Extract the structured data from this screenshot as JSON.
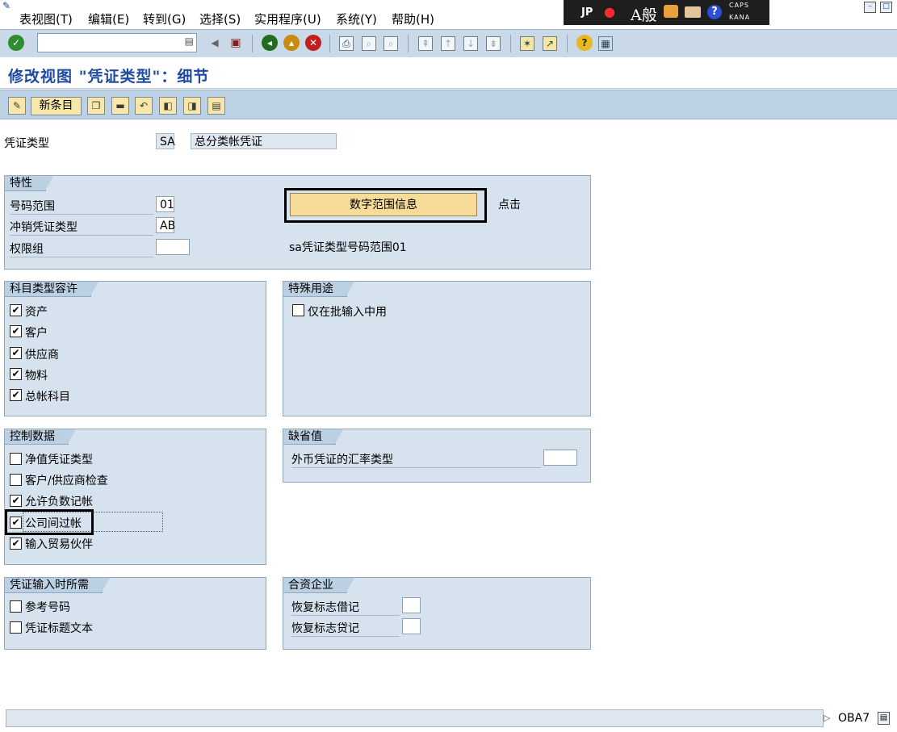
{
  "menu": {
    "items": [
      "表视图(T)",
      "编辑(E)",
      "转到(G)",
      "选择(S)",
      "实用程序(U)",
      "系统(Y)",
      "帮助(H)"
    ]
  },
  "ime": {
    "lang": "JP",
    "mode": "A般",
    "caps": "CAPS",
    "kana": "KANA"
  },
  "toolbar": {
    "command_value": ""
  },
  "title": "修改视图 \"凭证类型\"：细节",
  "app_toolbar": {
    "new_entries": "新条目"
  },
  "header": {
    "doc_type_label": "凭证类型",
    "doc_type_value": "SA",
    "doc_type_desc": "总分类帐凭证"
  },
  "properties": {
    "title": "特性",
    "number_range_label": "号码范围",
    "number_range_value": "01",
    "reverse_type_label": "冲销凭证类型",
    "reverse_type_value": "AB",
    "auth_group_label": "权限组",
    "auth_group_value": "",
    "nr_button": "数字范围信息",
    "click_note": "点击",
    "annotation": "sa凭证类型号码范围01"
  },
  "account_types": {
    "title": "科目类型容许",
    "items": [
      {
        "label": "资产",
        "checked": "✔"
      },
      {
        "label": "客户",
        "checked": "✔"
      },
      {
        "label": "供应商",
        "checked": "✔"
      },
      {
        "label": "物料",
        "checked": "✔"
      },
      {
        "label": "总帐科目",
        "checked": "✔"
      }
    ]
  },
  "special_usage": {
    "title": "特殊用途",
    "items": [
      {
        "label": "仅在批输入中用",
        "checked": ""
      }
    ]
  },
  "control_data": {
    "title": "控制数据",
    "items": [
      {
        "label": "净值凭证类型",
        "checked": ""
      },
      {
        "label": "客户/供应商检查",
        "checked": ""
      },
      {
        "label": "允许负数记帐",
        "checked": "✔"
      },
      {
        "label": "公司间过帐",
        "checked": "✔"
      },
      {
        "label": "输入贸易伙伴",
        "checked": "✔"
      }
    ]
  },
  "default_values": {
    "title": "缺省值",
    "fx_rate_label": "外币凭证的汇率类型",
    "fx_rate_value": ""
  },
  "required_entry": {
    "title": "凭证输入时所需",
    "items": [
      {
        "label": "参考号码",
        "checked": ""
      },
      {
        "label": "凭证标题文本",
        "checked": ""
      }
    ]
  },
  "joint_venture": {
    "title": "合资企业",
    "debit_label": "恢复标志借记",
    "debit_value": "",
    "credit_label": "恢复标志贷记",
    "credit_value": ""
  },
  "status": {
    "message": "",
    "transaction": "OBA7"
  }
}
